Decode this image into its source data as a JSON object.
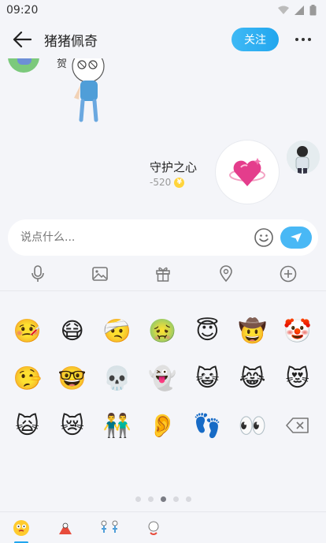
{
  "status_bar": {
    "time": "09:20",
    "icons": [
      "wifi-icon",
      "signal-icon",
      "battery-icon"
    ]
  },
  "header": {
    "title": "猪猪佩奇",
    "follow_label": "关注",
    "back_icon": "arrow-left-icon",
    "more_icon": "more-dots-icon"
  },
  "chat": {
    "peer_partial_text": "贺",
    "gift_message": {
      "name": "守护之心",
      "price": "-520",
      "coin_symbol": "¥"
    }
  },
  "input": {
    "placeholder": "说点什么...",
    "emoji_icon": "smiley-icon",
    "send_icon": "paper-plane-icon"
  },
  "tools": [
    {
      "name": "microphone-icon"
    },
    {
      "name": "image-icon"
    },
    {
      "name": "gift-icon"
    },
    {
      "name": "location-icon"
    },
    {
      "name": "plus-icon"
    }
  ],
  "emoji_panel": {
    "emojis": [
      "🤒",
      "😷",
      "🤕",
      "🤢",
      "😇",
      "🤠",
      "🤡",
      "🤥",
      "🤓",
      "💀",
      "👻",
      "😺",
      "😹",
      "😻",
      "🙀",
      "😿",
      "👬",
      "👂",
      "👣",
      "👀"
    ],
    "delete_icon": "backspace-icon",
    "page_count": 5,
    "active_page": 3
  },
  "sticker_tabs": [
    "emoji-tab",
    "sticker-pack-1",
    "sticker-pack-2",
    "sticker-pack-3"
  ],
  "colors": {
    "accent": "#21a6ee",
    "background": "#f4f5f9",
    "coin": "#ffd43b"
  }
}
